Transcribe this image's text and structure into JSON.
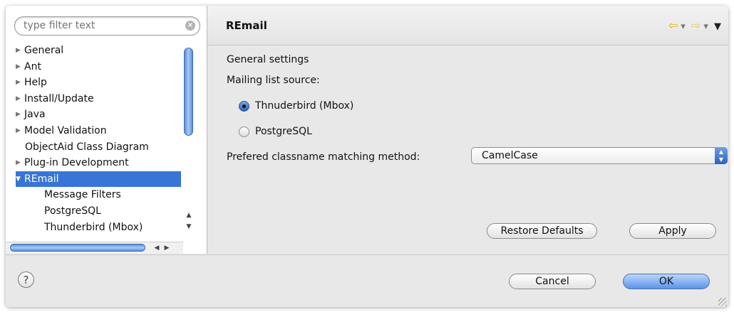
{
  "filter": {
    "placeholder": "type filter text"
  },
  "tree": {
    "items": [
      {
        "label": "General",
        "expandable": true
      },
      {
        "label": "Ant",
        "expandable": true
      },
      {
        "label": "Help",
        "expandable": true
      },
      {
        "label": "Install/Update",
        "expandable": true
      },
      {
        "label": "Java",
        "expandable": true
      },
      {
        "label": "Model Validation",
        "expandable": true
      },
      {
        "label": "ObjectAid Class Diagram",
        "expandable": false
      },
      {
        "label": "Plug-in Development",
        "expandable": true
      },
      {
        "label": "REmail",
        "expandable": true,
        "expanded": true,
        "selected": true
      },
      {
        "label": "Message Filters",
        "child": true
      },
      {
        "label": "PostgreSQL",
        "child": true
      },
      {
        "label": "Thunderbird (Mbox)",
        "child": true
      }
    ]
  },
  "page": {
    "title": "REmail",
    "general_settings": "General settings",
    "mailing_list_source": "Mailing list source:",
    "radio_thunderbird": "Thnuderbird (Mbox)",
    "radio_postgresql": "PostgreSQL",
    "selected_source": "Thnuderbird (Mbox)",
    "matching_label": "Prefered classname matching method:",
    "matching_value": "CamelCase",
    "restore_defaults": "Restore Defaults",
    "apply": "Apply"
  },
  "footer": {
    "cancel": "Cancel",
    "ok": "OK"
  },
  "colors": {
    "selection": "#3875d7",
    "accent": "#5c94e8"
  }
}
